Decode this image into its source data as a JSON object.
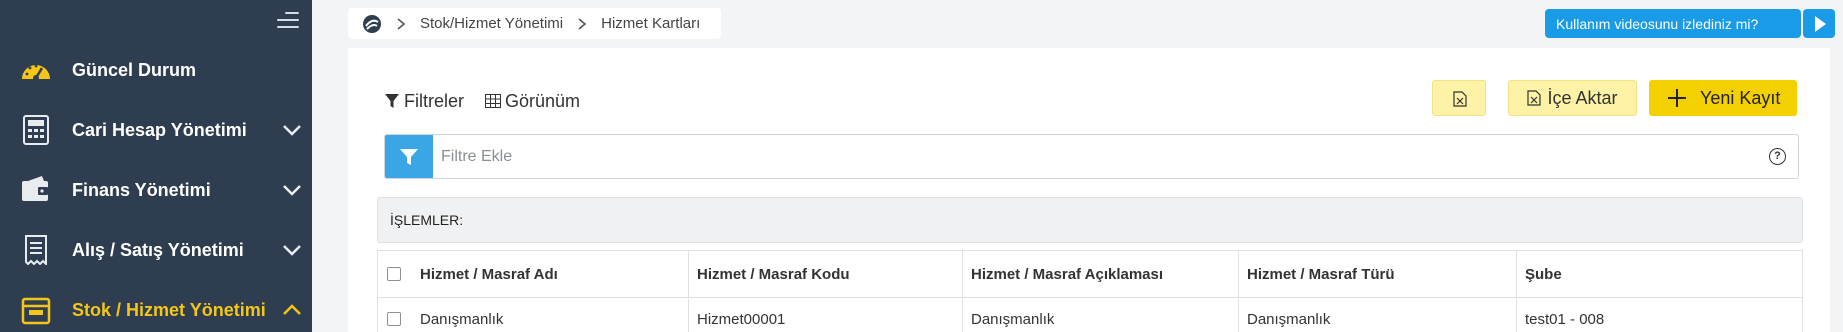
{
  "sidebar": {
    "menu_icon": "hamburger-icon",
    "items": [
      {
        "label": "Güncel Durum",
        "icon": "gauge-icon",
        "has_chevron": false
      },
      {
        "label": "Cari Hesap Yönetimi",
        "icon": "calculator-icon",
        "has_chevron": true
      },
      {
        "label": "Finans Yönetimi",
        "icon": "wallet-icon",
        "has_chevron": true
      },
      {
        "label": "Alış / Satış Yönetimi",
        "icon": "receipt-icon",
        "has_chevron": true
      },
      {
        "label": "Stok / Hizmet Yönetimi",
        "icon": "box-icon",
        "has_chevron": true,
        "active": true
      }
    ]
  },
  "breadcrumb": {
    "home_icon": "logo-icon",
    "items": [
      "Stok/Hizmet Yönetimi",
      "Hizmet Kartları"
    ]
  },
  "video_prompt": {
    "label": "Kullanım videosunu izlediniz mi?",
    "icon": "play-icon"
  },
  "toolbar": {
    "filters_label": "Filtreler",
    "view_label": "Görünüm",
    "export_icon": "excel-icon",
    "import_label": "İçe Aktar",
    "new_label": "Yeni Kayıt"
  },
  "filter": {
    "placeholder": "Filtre Ekle",
    "value": "",
    "help_icon": "question-icon"
  },
  "operations": {
    "label": "İŞLEMLER:"
  },
  "table": {
    "columns": [
      "Hizmet / Masraf Adı",
      "Hizmet / Masraf Kodu",
      "Hizmet / Masraf Açıklaması",
      "Hizmet / Masraf Türü",
      "Şube"
    ],
    "rows": [
      [
        "Danışmanlık",
        "Hizmet00001",
        "Danışmanlık",
        "Danışmanlık",
        "test01 - 008"
      ]
    ]
  },
  "colors": {
    "sidebar_bg": "#2e3e50",
    "active": "#f5c518",
    "accent_blue": "#1a9be8",
    "primary_yellow": "#f5d000",
    "soft_yellow": "#fdf2a6"
  }
}
